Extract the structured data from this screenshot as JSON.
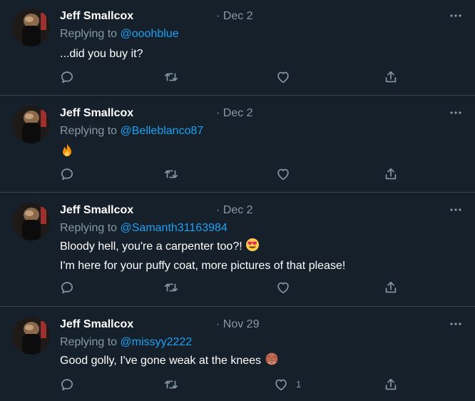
{
  "tweets": [
    {
      "author": "Jeff Smallcox",
      "date": "· Dec 2",
      "replying_prefix": "Replying to",
      "replying_handle": "@ooohblue",
      "text": "...did you buy it?",
      "like_count": ""
    },
    {
      "author": "Jeff Smallcox",
      "date": "· Dec 2",
      "replying_prefix": "Replying to",
      "replying_handle": "@Belleblanco87",
      "emoji": "fire",
      "like_count": ""
    },
    {
      "author": "Jeff Smallcox",
      "date": "· Dec 2",
      "replying_prefix": "Replying to",
      "replying_handle": "@Samanth31163984",
      "text_line1": "Bloody hell, you're a carpenter too?!",
      "emoji": "heart-eyes",
      "text_line2": "I'm here for your puffy coat, more pictures of that please!",
      "like_count": ""
    },
    {
      "author": "Jeff Smallcox",
      "date": "· Nov 29",
      "replying_prefix": "Replying to",
      "replying_handle": "@missyy2222",
      "text": "Good golly, I've gone weak at the knees",
      "emoji": "see-no-evil-monkey",
      "like_count": "1"
    }
  ],
  "colors": {
    "background": "#15202b",
    "secondary_text": "#8899a6",
    "link": "#1da1f2",
    "divider": "#38444d"
  },
  "icons": [
    "reply-icon",
    "retweet-icon",
    "like-icon",
    "share-icon",
    "more-icon"
  ]
}
